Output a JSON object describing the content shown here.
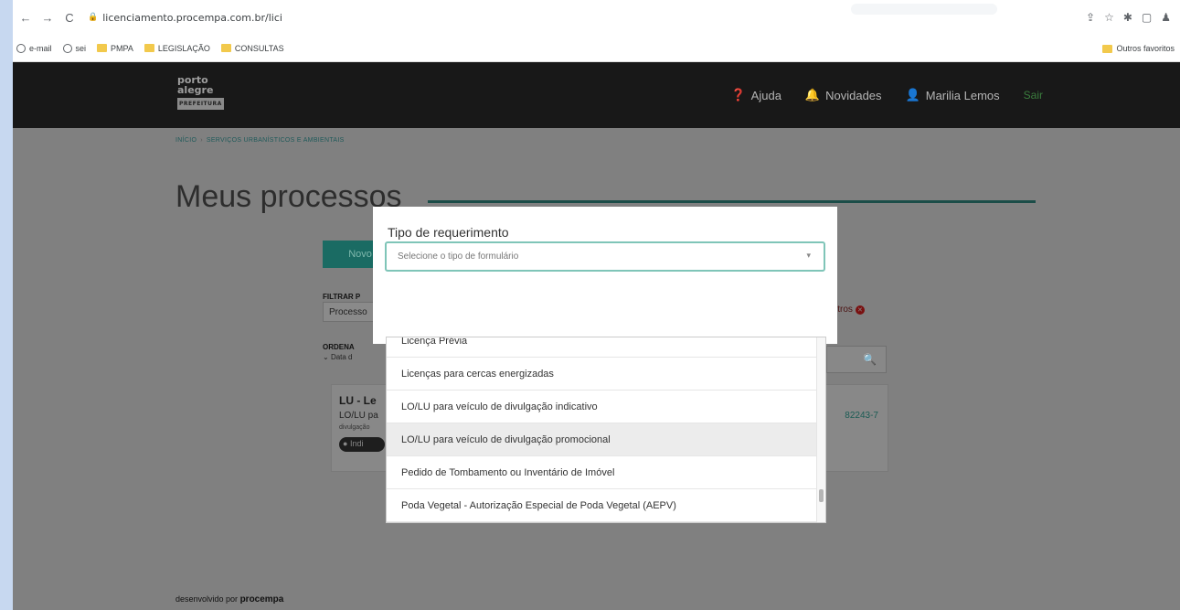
{
  "browser": {
    "url": "licenciamento.procempa.com.br/lici",
    "bookmarks": [
      "e-mail",
      "sei",
      "PMPA",
      "LEGISLAÇÃO",
      "CONSULTAS"
    ],
    "other_bookmarks": "Outros favoritos"
  },
  "header": {
    "logo_line1": "porto",
    "logo_line2": "alegre",
    "logo_bar": "PREFEITURA",
    "nav": [
      {
        "icon": "help-circle-icon",
        "label": "Ajuda"
      },
      {
        "icon": "bell-icon",
        "label": "Novidades"
      },
      {
        "icon": "user-icon",
        "label": "Marilia Lemos"
      }
    ],
    "logout": "Sair"
  },
  "breadcrumb": [
    "INÍCIO",
    "SERVIÇOS URBANÍSTICOS E AMBIENTAIS"
  ],
  "main": {
    "title": "Meus processos",
    "new_button": "Novo Processo",
    "filter_label": "FILTRAR P",
    "filter_value": "Processo",
    "clear_filters": "ltros",
    "order_label": "ORDENA",
    "order_value": "Data d",
    "card": {
      "title": "LU - Le",
      "subtitle": "LO/LU pa",
      "subtitle2": "divulgação",
      "badge": "Indi",
      "number": "82243-7"
    }
  },
  "footer": {
    "prefix": "desenvolvido por",
    "brand": "procempa"
  },
  "modal": {
    "label": "Tipo de requerimento",
    "placeholder": "Selecione o tipo de formulário",
    "options": [
      "Licença Prévia",
      "Licenças para cercas energizadas",
      "LO/LU para veículo de divulgação indicativo",
      "LO/LU para veículo de divulgação promocional",
      "Pedido de Tombamento ou Inventário de Imóvel",
      "Poda Vegetal - Autorização Especial de Poda Vegetal (AEPV)"
    ],
    "highlighted_index": 3
  }
}
